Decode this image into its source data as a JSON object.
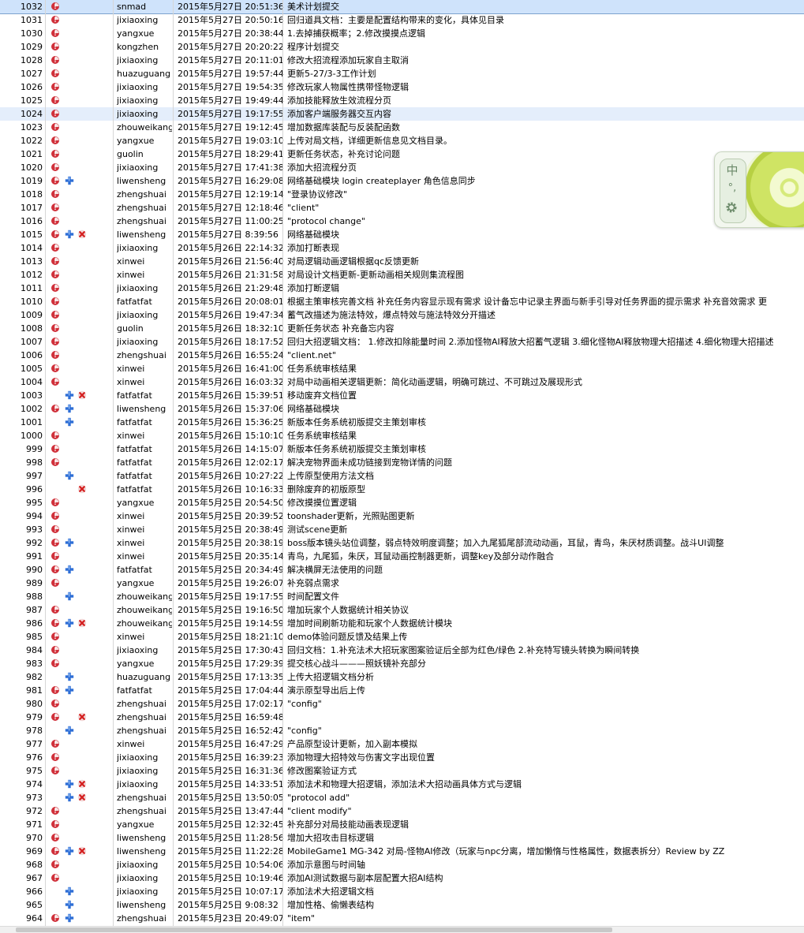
{
  "ime": {
    "mode_char": "中",
    "punct": "°,",
    "settings_icon": "gear-icon"
  },
  "icons": {
    "status": "red-circle-icon",
    "added": "blue-plus-icon",
    "deleted": "red-x-icon"
  },
  "colors": {
    "selected_row": "#cfe3fb",
    "highlight_row": "#e4eefb",
    "status_red": "#d0303a",
    "added_blue": "#2f6fd6"
  },
  "commits": [
    {
      "rev": "1032",
      "actions": [
        "status"
      ],
      "author": "snmad",
      "date": "2015年5月27日 20:51:36",
      "message": "美术计划提交",
      "selected": true
    },
    {
      "rev": "1031",
      "actions": [
        "status"
      ],
      "author": "jixiaoxing",
      "date": "2015年5月27日 20:50:16",
      "message": "回归道具文档：主要是配置结构带来的变化，具体见目录"
    },
    {
      "rev": "1030",
      "actions": [
        "status"
      ],
      "author": "yangxue",
      "date": "2015年5月27日 20:38:44",
      "message": "1.去掉捕获概率；2.修改摸摸点逻辑"
    },
    {
      "rev": "1029",
      "actions": [
        "status"
      ],
      "author": "kongzhen",
      "date": "2015年5月27日 20:20:22",
      "message": "程序计划提交"
    },
    {
      "rev": "1028",
      "actions": [
        "status"
      ],
      "author": "jixiaoxing",
      "date": "2015年5月27日 20:11:01",
      "message": "修改大招流程添加玩家自主取消"
    },
    {
      "rev": "1027",
      "actions": [
        "status"
      ],
      "author": "huazuguang",
      "date": "2015年5月27日 19:57:44",
      "message": "更新5-27/3-3工作计划"
    },
    {
      "rev": "1026",
      "actions": [
        "status"
      ],
      "author": "jixiaoxing",
      "date": "2015年5月27日 19:54:35",
      "message": "修改玩家人物属性携带怪物逻辑"
    },
    {
      "rev": "1025",
      "actions": [
        "status"
      ],
      "author": "jixiaoxing",
      "date": "2015年5月27日 19:49:44",
      "message": "添加技能释放生效流程分页"
    },
    {
      "rev": "1024",
      "actions": [
        "status"
      ],
      "author": "jixiaoxing",
      "date": "2015年5月27日 19:17:55",
      "message": "添加客户端服务器交互内容",
      "highlight": true
    },
    {
      "rev": "1023",
      "actions": [
        "status"
      ],
      "author": "zhouweikang",
      "date": "2015年5月27日 19:12:45",
      "message": "增加数据库装配与反装配函数"
    },
    {
      "rev": "1022",
      "actions": [
        "status"
      ],
      "author": "yangxue",
      "date": "2015年5月27日 19:03:10",
      "message": "上传对局文档，详细更新信息见文档目录。"
    },
    {
      "rev": "1021",
      "actions": [
        "status"
      ],
      "author": "guolin",
      "date": "2015年5月27日 18:29:41",
      "message": "更新任务状态，补充讨论问题"
    },
    {
      "rev": "1020",
      "actions": [
        "status"
      ],
      "author": "jixiaoxing",
      "date": "2015年5月27日 17:41:38",
      "message": "添加大招流程分页"
    },
    {
      "rev": "1019",
      "actions": [
        "status",
        "added"
      ],
      "author": "liwensheng",
      "date": "2015年5月27日 16:29:08",
      "message": "网络基础模块 login createplayer 角色信息同步"
    },
    {
      "rev": "1018",
      "actions": [
        "status"
      ],
      "author": "zhengshuai",
      "date": "2015年5月27日 12:19:14",
      "message": "\"登录协议修改\""
    },
    {
      "rev": "1017",
      "actions": [
        "status"
      ],
      "author": "zhengshuai",
      "date": "2015年5月27日 12:18:46",
      "message": "\"client\""
    },
    {
      "rev": "1016",
      "actions": [
        "status"
      ],
      "author": "zhengshuai",
      "date": "2015年5月27日 11:00:25",
      "message": "\"protocol change\""
    },
    {
      "rev": "1015",
      "actions": [
        "status",
        "added",
        "deleted"
      ],
      "author": "liwensheng",
      "date": "2015年5月27日 8:39:56",
      "message": "网络基础模块"
    },
    {
      "rev": "1014",
      "actions": [
        "status"
      ],
      "author": "jixiaoxing",
      "date": "2015年5月26日 22:14:32",
      "message": "添加打断表现"
    },
    {
      "rev": "1013",
      "actions": [
        "status"
      ],
      "author": "xinwei",
      "date": "2015年5月26日 21:56:40",
      "message": "对局逻辑动画逻辑根据qc反馈更新"
    },
    {
      "rev": "1012",
      "actions": [
        "status"
      ],
      "author": "xinwei",
      "date": "2015年5月26日 21:31:58",
      "message": "对局设计文档更新-更新动画相关规则集流程图"
    },
    {
      "rev": "1011",
      "actions": [
        "status"
      ],
      "author": "jixiaoxing",
      "date": "2015年5月26日 21:29:48",
      "message": "添加打断逻辑"
    },
    {
      "rev": "1010",
      "actions": [
        "status"
      ],
      "author": "fatfatfat",
      "date": "2015年5月26日 20:08:01",
      "message": "根据主策审核完善文档 补充任务内容显示现有需求 设计备忘中记录主界面与新手引导对任务界面的提示需求 补充音效需求 更"
    },
    {
      "rev": "1009",
      "actions": [
        "status"
      ],
      "author": "jixiaoxing",
      "date": "2015年5月26日 19:47:34",
      "message": "蓄气改描述为施法特效，爆点特效与施法特效分开描述"
    },
    {
      "rev": "1008",
      "actions": [
        "status"
      ],
      "author": "guolin",
      "date": "2015年5月26日 18:32:10",
      "message": "更新任务状态 补充备忘内容"
    },
    {
      "rev": "1007",
      "actions": [
        "status"
      ],
      "author": "jixiaoxing",
      "date": "2015年5月26日 18:17:52",
      "message": "回归大招逻辑文档： 1.修改扣除能量时间 2.添加怪物AI释放大招蓄气逻辑 3.细化怪物AI释放物理大招描述 4.细化物理大招描述"
    },
    {
      "rev": "1006",
      "actions": [
        "status"
      ],
      "author": "zhengshuai",
      "date": "2015年5月26日 16:55:24",
      "message": "\"client.net\""
    },
    {
      "rev": "1005",
      "actions": [
        "status"
      ],
      "author": "xinwei",
      "date": "2015年5月26日 16:41:00",
      "message": "任务系统审核结果"
    },
    {
      "rev": "1004",
      "actions": [
        "status"
      ],
      "author": "xinwei",
      "date": "2015年5月26日 16:03:32",
      "message": "对局中动画相关逻辑更新：简化动画逻辑，明确可跳过、不可跳过及展现形式"
    },
    {
      "rev": "1003",
      "actions": [
        "added",
        "deleted"
      ],
      "author": "fatfatfat",
      "date": "2015年5月26日 15:39:51",
      "message": "移动废弃文档位置"
    },
    {
      "rev": "1002",
      "actions": [
        "status",
        "added"
      ],
      "author": "liwensheng",
      "date": "2015年5月26日 15:37:06",
      "message": "网络基础模块"
    },
    {
      "rev": "1001",
      "actions": [
        "added"
      ],
      "author": "fatfatfat",
      "date": "2015年5月26日 15:36:25",
      "message": "新版本任务系统初版提交主策划审核"
    },
    {
      "rev": "1000",
      "actions": [
        "status"
      ],
      "author": "xinwei",
      "date": "2015年5月26日 15:10:10",
      "message": "任务系统审核结果"
    },
    {
      "rev": "999",
      "actions": [
        "status"
      ],
      "author": "fatfatfat",
      "date": "2015年5月26日 14:15:07",
      "message": "新版本任务系统初版提交主策划审核"
    },
    {
      "rev": "998",
      "actions": [
        "status"
      ],
      "author": "fatfatfat",
      "date": "2015年5月26日 12:02:17",
      "message": "解决宠物界面未成功链接到宠物详情的问题"
    },
    {
      "rev": "997",
      "actions": [
        "added"
      ],
      "author": "fatfatfat",
      "date": "2015年5月26日 10:27:22",
      "message": "上传原型使用方法文档"
    },
    {
      "rev": "996",
      "actions": [
        "deleted"
      ],
      "author": "fatfatfat",
      "date": "2015年5月26日 10:16:33",
      "message": "删除废弃的初版原型"
    },
    {
      "rev": "995",
      "actions": [
        "status"
      ],
      "author": "yangxue",
      "date": "2015年5月25日 20:54:50",
      "message": "修改摸摸位置逻辑"
    },
    {
      "rev": "994",
      "actions": [
        "status"
      ],
      "author": "xinwei",
      "date": "2015年5月25日 20:39:52",
      "message": "toonshader更新，光照贴图更新"
    },
    {
      "rev": "993",
      "actions": [
        "status"
      ],
      "author": "xinwei",
      "date": "2015年5月25日 20:38:49",
      "message": "测试scene更新"
    },
    {
      "rev": "992",
      "actions": [
        "status",
        "added"
      ],
      "author": "xinwei",
      "date": "2015年5月25日 20:38:19",
      "message": "boss版本镜头站位调整，弱点特效明度调整；加入九尾狐尾部流动动画，耳鼠，青鸟，朱厌材质调整。战斗UI调整"
    },
    {
      "rev": "991",
      "actions": [
        "status"
      ],
      "author": "xinwei",
      "date": "2015年5月25日 20:35:14",
      "message": "青鸟，九尾狐，朱厌，耳鼠动画控制器更新，调整key及部分动作融合"
    },
    {
      "rev": "990",
      "actions": [
        "status",
        "added"
      ],
      "author": "fatfatfat",
      "date": "2015年5月25日 20:34:49",
      "message": "解决横屏无法使用的问题"
    },
    {
      "rev": "989",
      "actions": [
        "status"
      ],
      "author": "yangxue",
      "date": "2015年5月25日 19:26:07",
      "message": "补充弱点需求"
    },
    {
      "rev": "988",
      "actions": [
        "added"
      ],
      "author": "zhouweikang",
      "date": "2015年5月25日 19:17:55",
      "message": "时间配置文件"
    },
    {
      "rev": "987",
      "actions": [
        "status"
      ],
      "author": "zhouweikang",
      "date": "2015年5月25日 19:16:50",
      "message": "增加玩家个人数据统计相关协议"
    },
    {
      "rev": "986",
      "actions": [
        "status",
        "added",
        "deleted"
      ],
      "author": "zhouweikang",
      "date": "2015年5月25日 19:14:59",
      "message": "增加时间刷新功能和玩家个人数据统计模块"
    },
    {
      "rev": "985",
      "actions": [
        "status"
      ],
      "author": "xinwei",
      "date": "2015年5月25日 18:21:10",
      "message": "demo体验问题反馈及结果上传"
    },
    {
      "rev": "984",
      "actions": [
        "status"
      ],
      "author": "jixiaoxing",
      "date": "2015年5月25日 17:30:43",
      "message": "回归文档：1.补充法术大招玩家图案验证后全部为红色/绿色 2.补充特写镜头转换为瞬间转换"
    },
    {
      "rev": "983",
      "actions": [
        "status"
      ],
      "author": "yangxue",
      "date": "2015年5月25日 17:29:39",
      "message": "提交核心战斗———照妖镜补充部分"
    },
    {
      "rev": "982",
      "actions": [
        "added"
      ],
      "author": "huazuguang",
      "date": "2015年5月25日 17:13:35",
      "message": "上传大招逻辑文档分析"
    },
    {
      "rev": "981",
      "actions": [
        "status",
        "added"
      ],
      "author": "fatfatfat",
      "date": "2015年5月25日 17:04:44",
      "message": "演示原型导出后上传"
    },
    {
      "rev": "980",
      "actions": [
        "status"
      ],
      "author": "zhengshuai",
      "date": "2015年5月25日 17:02:17",
      "message": "\"config\""
    },
    {
      "rev": "979",
      "actions": [
        "status",
        "deleted"
      ],
      "author": "zhengshuai",
      "date": "2015年5月25日 16:59:48",
      "message": ""
    },
    {
      "rev": "978",
      "actions": [
        "added"
      ],
      "author": "zhengshuai",
      "date": "2015年5月25日 16:52:42",
      "message": "\"config\""
    },
    {
      "rev": "977",
      "actions": [
        "status"
      ],
      "author": "xinwei",
      "date": "2015年5月25日 16:47:29",
      "message": "产品原型设计更新，加入副本模拟"
    },
    {
      "rev": "976",
      "actions": [
        "status"
      ],
      "author": "jixiaoxing",
      "date": "2015年5月25日 16:39:23",
      "message": "添加物理大招特效与伤害文字出现位置"
    },
    {
      "rev": "975",
      "actions": [
        "status"
      ],
      "author": "jixiaoxing",
      "date": "2015年5月25日 16:31:36",
      "message": "修改图案验证方式"
    },
    {
      "rev": "974",
      "actions": [
        "added",
        "deleted"
      ],
      "author": "jixiaoxing",
      "date": "2015年5月25日 14:33:51",
      "message": "添加法术和物理大招逻辑，添加法术大招动画具体方式与逻辑"
    },
    {
      "rev": "973",
      "actions": [
        "added",
        "deleted"
      ],
      "author": "zhengshuai",
      "date": "2015年5月25日 13:50:05",
      "message": "\"protocol add\""
    },
    {
      "rev": "972",
      "actions": [
        "status"
      ],
      "author": "zhengshuai",
      "date": "2015年5月25日 13:47:44",
      "message": "\"client modify\""
    },
    {
      "rev": "971",
      "actions": [
        "status"
      ],
      "author": "yangxue",
      "date": "2015年5月25日 12:32:45",
      "message": "补充部分对局技能动画表现逻辑"
    },
    {
      "rev": "970",
      "actions": [
        "status"
      ],
      "author": "liwensheng",
      "date": "2015年5月25日 11:28:56",
      "message": "增加大招攻击目标逻辑"
    },
    {
      "rev": "969",
      "actions": [
        "status",
        "added",
        "deleted"
      ],
      "author": "liwensheng",
      "date": "2015年5月25日 11:22:28",
      "message": "MobileGame1 MG-342 对局-怪物AI修改（玩家与npc分离，增加懒惰与性格属性，数据表拆分）Review by ZZ"
    },
    {
      "rev": "968",
      "actions": [
        "status"
      ],
      "author": "jixiaoxing",
      "date": "2015年5月25日 10:54:06",
      "message": "添加示意图与时间轴"
    },
    {
      "rev": "967",
      "actions": [
        "status"
      ],
      "author": "jixiaoxing",
      "date": "2015年5月25日 10:19:46",
      "message": "添加AI测试数据与副本层配置大招AI结构"
    },
    {
      "rev": "966",
      "actions": [
        "added"
      ],
      "author": "jixiaoxing",
      "date": "2015年5月25日 10:07:17",
      "message": "添加法术大招逻辑文档"
    },
    {
      "rev": "965",
      "actions": [
        "added"
      ],
      "author": "liwensheng",
      "date": "2015年5月25日 9:08:32",
      "message": "增加性格、偷懒表结构"
    },
    {
      "rev": "964",
      "actions": [
        "status",
        "added"
      ],
      "author": "zhengshuai",
      "date": "2015年5月23日 20:49:07",
      "message": "\"item\""
    }
  ]
}
